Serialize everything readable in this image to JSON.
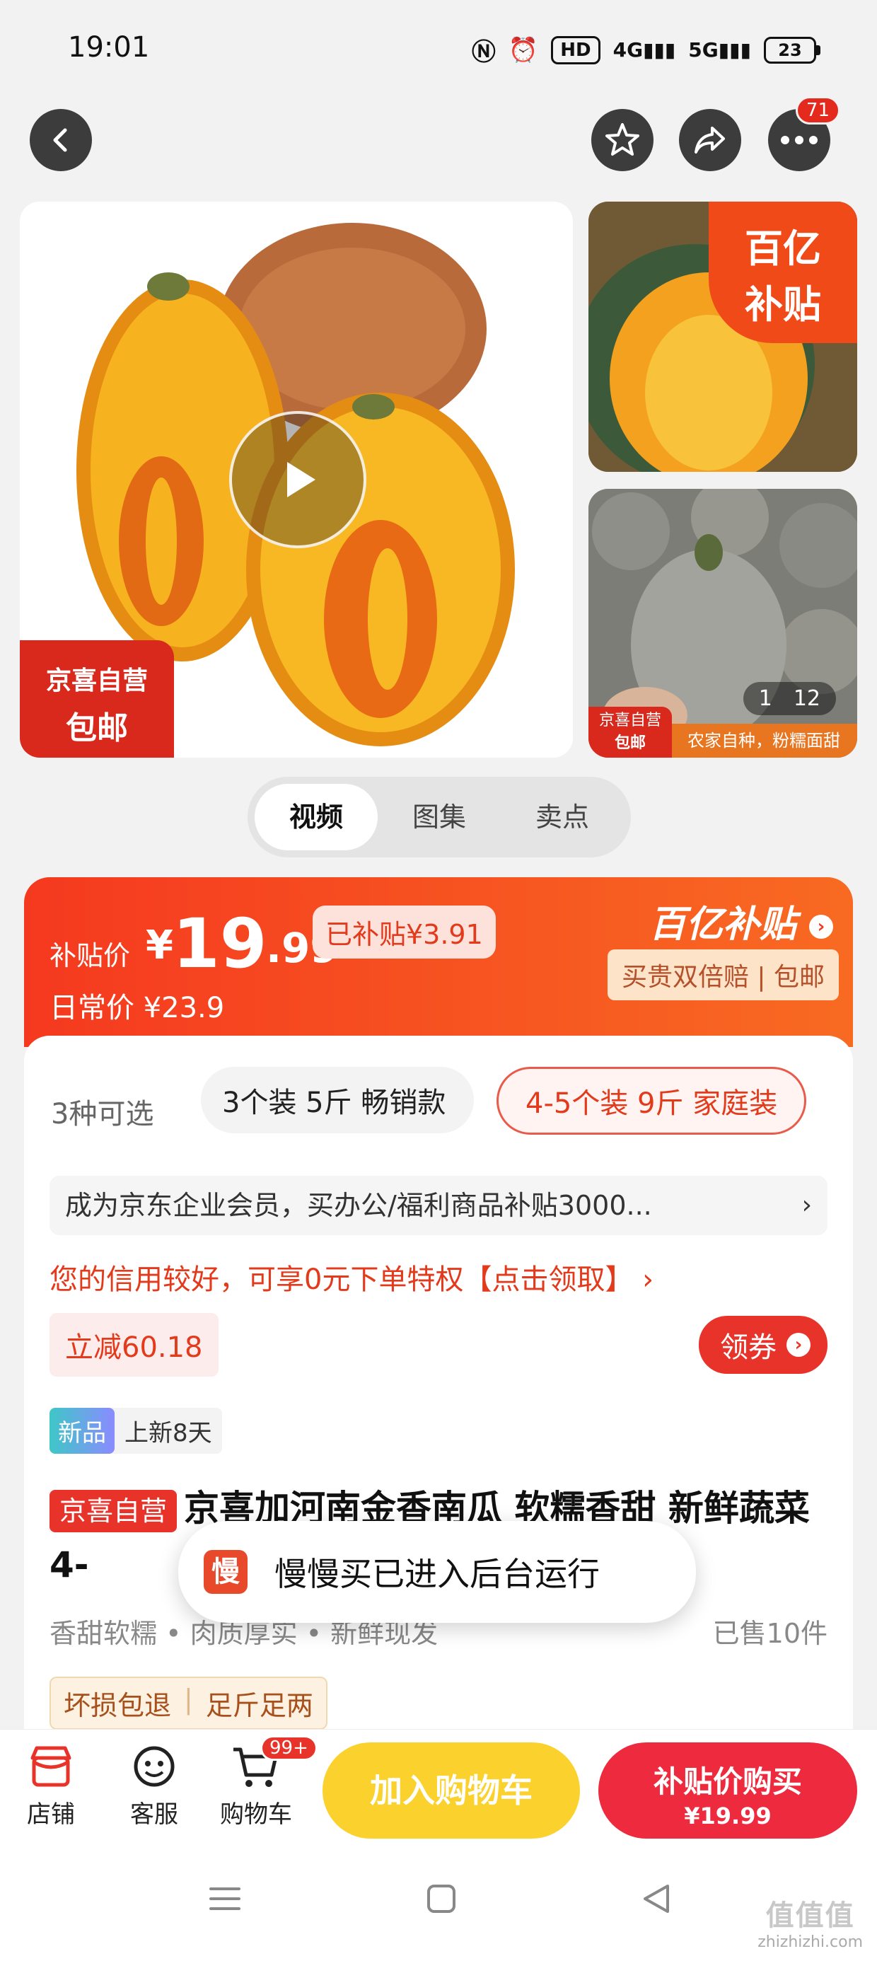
{
  "status_bar": {
    "time": "19:01",
    "hd_label": "HD",
    "net1": "4G",
    "net2": "5G",
    "battery": "23"
  },
  "nav": {
    "back_icon": "chevron-left-icon",
    "favorite_icon": "star-icon",
    "share_icon": "share-icon",
    "more_icon": "more-dots-icon",
    "more_badge": "71"
  },
  "gallery": {
    "main_tag_line1": "京喜自营",
    "main_tag_line2": "包邮",
    "subsidy_line1": "百亿",
    "subsidy_line2": "补贴",
    "counter_current": "1",
    "counter_total": "12",
    "side_tag_line1": "京喜自营",
    "side_tag_line2": "包邮",
    "side_strip_text": "农家自种，粉糯面甜"
  },
  "tabs": [
    {
      "label": "视频",
      "active": true
    },
    {
      "label": "图集",
      "active": false
    },
    {
      "label": "卖点",
      "active": false
    }
  ],
  "price": {
    "label": "补贴价",
    "currency": "¥",
    "integer": "19",
    "decimal": ".99",
    "subsidized": "已补贴¥3.91",
    "daily": "日常价 ¥23.9",
    "program_logo": "百亿补贴",
    "guarantee": "买贵双倍赔 | 包邮"
  },
  "options": {
    "count": "3种可选",
    "option1": "3个装 5斤 畅销款",
    "option2": "4-5个装 9斤 家庭装"
  },
  "corp_banner": "成为京东企业会员，买办公/福利商品补贴3000...",
  "credit_text": "您的信用较好，可享0元下单特权【点击领取】 ›",
  "discount": "立减60.18",
  "coupon_label": "领券",
  "new_tag": {
    "badge": "新品",
    "days": "上新8天"
  },
  "product": {
    "store_tag": "京喜自营",
    "title": "京喜加河南金香南瓜 软糯香甜 新鲜蔬菜 4-",
    "features": "香甜软糯 • 肉质厚实 • 新鲜现发",
    "sold": "已售10件",
    "guarantee1": "坏损包退",
    "guarantee2": "足斤足两"
  },
  "toast": {
    "icon_char": "慢",
    "text": "慢慢买已进入后台运行"
  },
  "bottom_bar": {
    "store": "店铺",
    "service": "客服",
    "cart": "购物车",
    "cart_badge": "99+",
    "add_to_cart": "加入购物车",
    "buy_label": "补贴价购买",
    "buy_price": "¥19.99"
  },
  "watermark": {
    "big": "值值值",
    "small": "zhizhizhi.com"
  },
  "colors": {
    "accent_red": "#e8332a",
    "subsidy_orange": "#f5391f",
    "cart_yellow": "#fbd22d",
    "buy_red": "#ee2a3e"
  }
}
